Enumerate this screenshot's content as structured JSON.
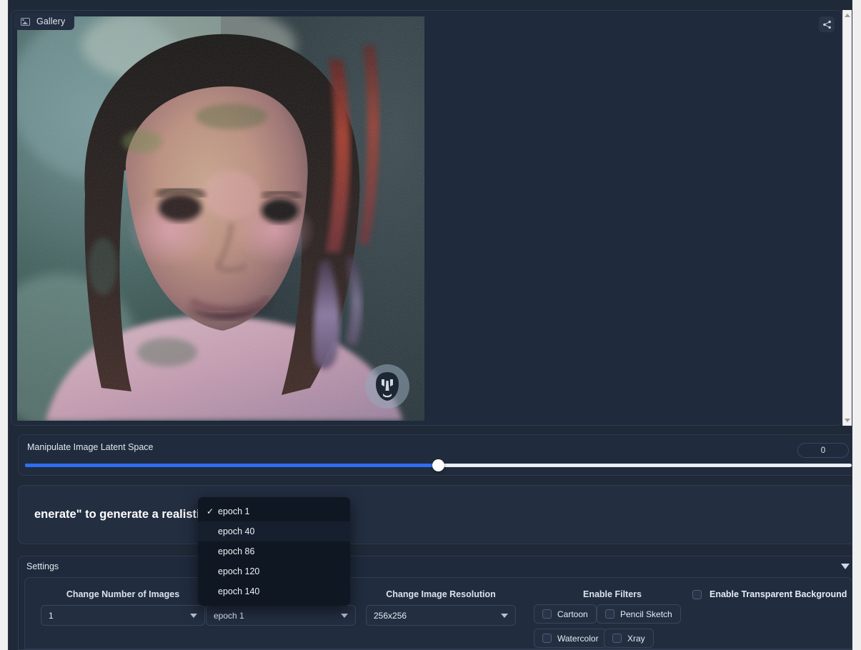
{
  "gallery": {
    "tab_label": "Gallery",
    "icon": "image-icon",
    "share_icon": "share-icon",
    "watermark_icon": "face-mask-watermark"
  },
  "slider": {
    "label": "Manipulate Image Latent Space",
    "value": "0",
    "percent": 50,
    "fill_color": "#2f6ef0",
    "track_color": "#eceef1"
  },
  "info": {
    "text": "enerate\" to generate a realistic face."
  },
  "settings": {
    "title": "Settings",
    "collapse_icon": "chevron-down-icon",
    "num_images": {
      "label": "Change Number of Images",
      "value": "1"
    },
    "epoch": {
      "label": "",
      "value": "epoch 1"
    },
    "resolution": {
      "label": "Change Image Resolution",
      "value": "256x256"
    },
    "filters": {
      "label": "Enable Filters",
      "items": [
        {
          "label": "Cartoon",
          "checked": false
        },
        {
          "label": "Pencil Sketch",
          "checked": false
        },
        {
          "label": "Watercolor",
          "checked": false
        },
        {
          "label": "Xray",
          "checked": false
        }
      ]
    },
    "transparent_bg": {
      "label": "Enable Transparent Background",
      "checked": false
    }
  },
  "dropdown": {
    "open": true,
    "selected": "epoch 1",
    "options": [
      {
        "label": "epoch 1",
        "checked": true,
        "highlighted": false
      },
      {
        "label": "epoch 40",
        "checked": false,
        "highlighted": true
      },
      {
        "label": "epoch 86",
        "checked": false,
        "highlighted": false
      },
      {
        "label": "epoch 120",
        "checked": false,
        "highlighted": false
      },
      {
        "label": "epoch 140",
        "checked": false,
        "highlighted": false
      }
    ]
  },
  "scrollbar": {
    "up_icon": "scroll-up-arrow",
    "down_icon": "scroll-down-arrow"
  },
  "theme": {
    "page_bg": "#1f2937",
    "panel_bg": "#1f2a3c",
    "accent": "#2f6ef0",
    "text": "#e2e8f0"
  }
}
